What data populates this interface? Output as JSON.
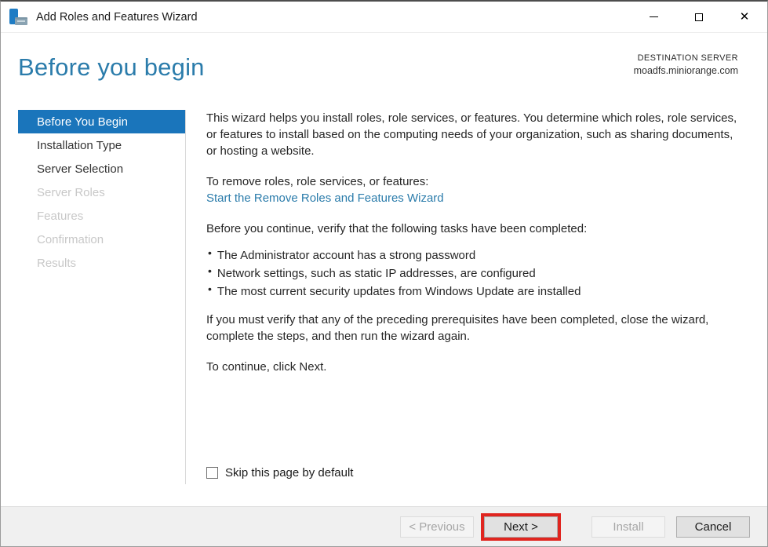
{
  "window": {
    "title": "Add Roles and Features Wizard",
    "icons": {
      "app_icon": "server-manager",
      "minimize_icon": "horizontal-line",
      "maximize_icon": "square-outline",
      "close_icon": "✕"
    }
  },
  "header": {
    "title": "Before you begin",
    "destination_label": "DESTINATION SERVER",
    "server_name": "moadfs.miniorange.com"
  },
  "sidebar": {
    "items": [
      {
        "label": "Before You Begin",
        "state": "selected"
      },
      {
        "label": "Installation Type",
        "state": "enabled"
      },
      {
        "label": "Server Selection",
        "state": "enabled"
      },
      {
        "label": "Server Roles",
        "state": "disabled"
      },
      {
        "label": "Features",
        "state": "disabled"
      },
      {
        "label": "Confirmation",
        "state": "disabled"
      },
      {
        "label": "Results",
        "state": "disabled"
      }
    ]
  },
  "content": {
    "intro_paragraph": "This wizard helps you install roles, role services, or features. You determine which roles, role services, or features to install based on the computing needs of your organization, such as sharing documents, or hosting a website.",
    "remove_intro": "To remove roles, role services, or features:",
    "remove_link_label": "Start the Remove Roles and Features Wizard",
    "verify_intro": "Before you continue, verify that the following tasks have been completed:",
    "bullets": [
      "The Administrator account has a strong password",
      "Network settings, such as static IP addresses, are configured",
      "The most current security updates from Windows Update are installed"
    ],
    "verify_note": "If you must verify that any of the preceding prerequisites have been completed, close the wizard, complete the steps, and then run the wizard again.",
    "continue_note": "To continue, click Next.",
    "skip_checkbox": {
      "label": "Skip this page by default",
      "checked": false
    }
  },
  "footer": {
    "previous_label": "< Previous",
    "next_label": "Next >",
    "install_label": "Install",
    "cancel_label": "Cancel"
  },
  "colors": {
    "accent_blue": "#1a75bb",
    "heading_blue": "#2b7cab",
    "link_blue": "#2b7cab",
    "highlight_red": "#e0251f",
    "footer_gray": "#f0f0f0"
  }
}
